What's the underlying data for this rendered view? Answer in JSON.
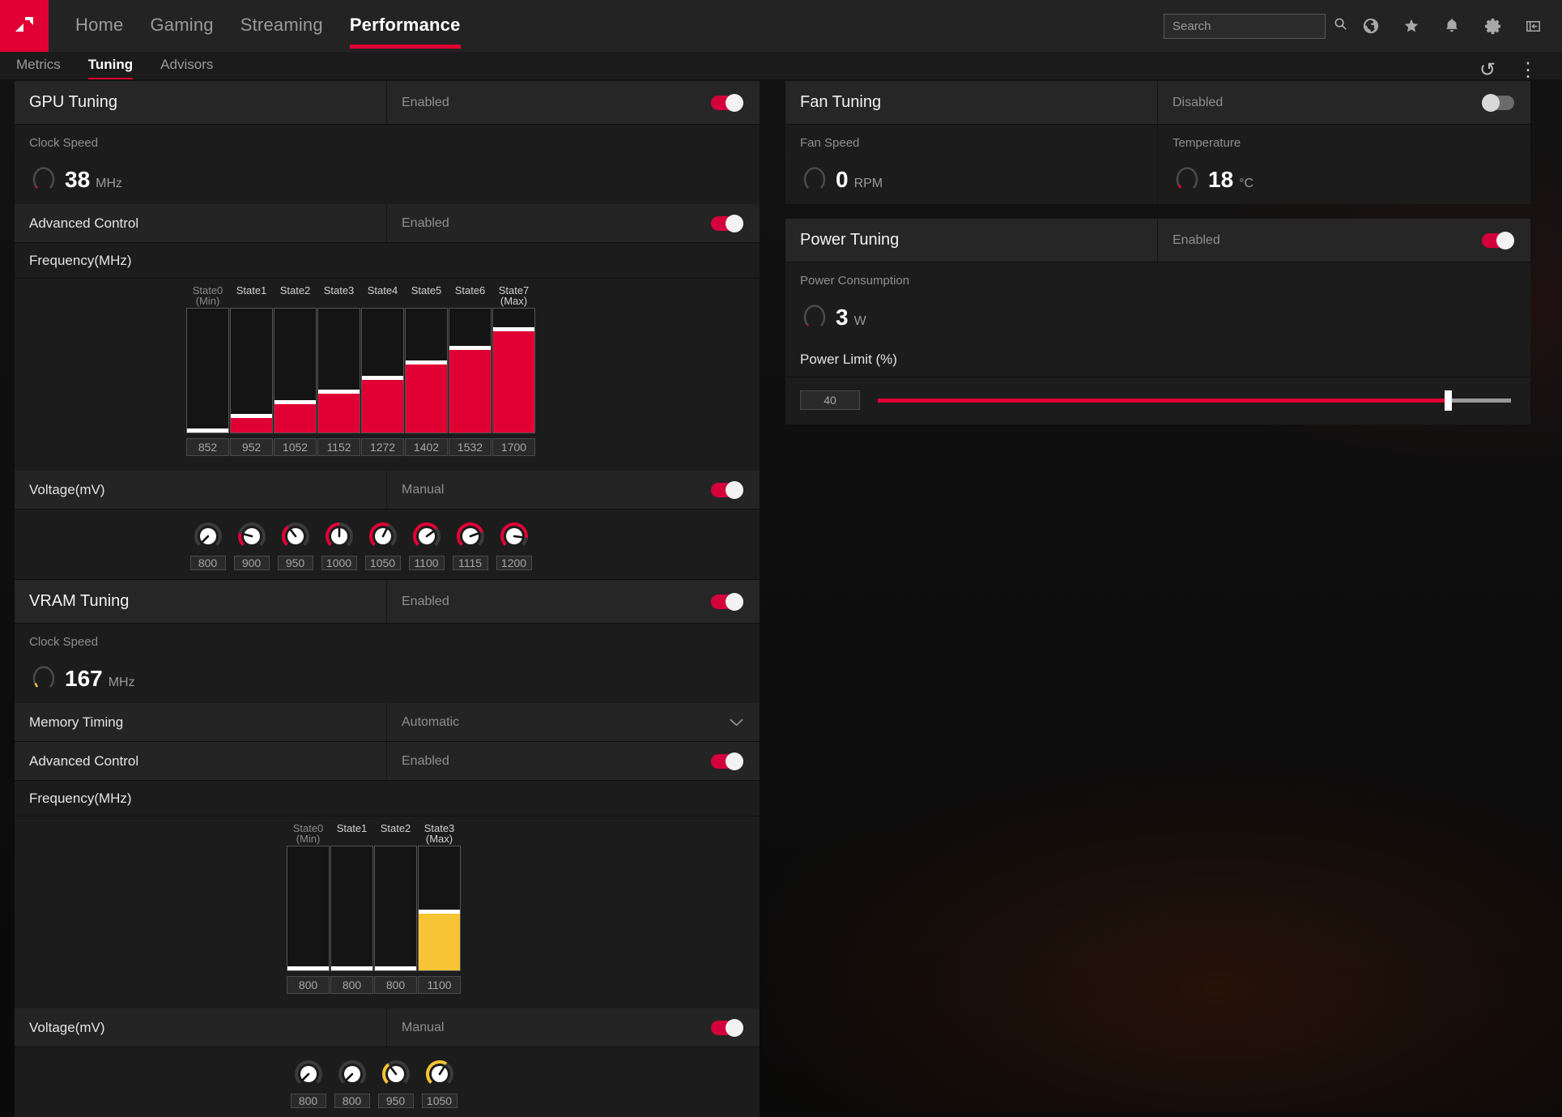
{
  "app": {
    "brand_color": "#e00034",
    "accent_yellow": "#f6c434",
    "logo_icon": "amd-arrow-icon"
  },
  "nav": {
    "items": [
      {
        "label": "Home",
        "active": false
      },
      {
        "label": "Gaming",
        "active": false
      },
      {
        "label": "Streaming",
        "active": false
      },
      {
        "label": "Performance",
        "active": true
      }
    ]
  },
  "search": {
    "placeholder": "Search",
    "value": "",
    "icon": "search-icon"
  },
  "topbar_icons": [
    {
      "name": "globe-icon"
    },
    {
      "name": "star-icon"
    },
    {
      "name": "bell-icon"
    },
    {
      "name": "gear-icon"
    },
    {
      "name": "panel-collapse-icon"
    }
  ],
  "subnav": {
    "items": [
      {
        "label": "Metrics",
        "active": false
      },
      {
        "label": "Tuning",
        "active": true
      },
      {
        "label": "Advisors",
        "active": false
      }
    ],
    "actions": [
      {
        "name": "reset-icon",
        "glyph": "↺"
      },
      {
        "name": "more-options-icon",
        "glyph": "⋮"
      }
    ]
  },
  "gpu_tuning": {
    "title": "GPU Tuning",
    "state_label": "Enabled",
    "enabled": true,
    "clock_speed": {
      "caption": "Clock Speed",
      "value": "38",
      "unit": "MHz",
      "gauge_pct": 4,
      "gauge_color": "#e00034"
    },
    "advanced_control": {
      "label": "Advanced Control",
      "state_label": "Enabled",
      "enabled": true
    },
    "frequency": {
      "label": "Frequency(MHz)"
    },
    "voltage": {
      "label": "Voltage(mV)",
      "state_label": "Manual",
      "enabled": true
    }
  },
  "vram_tuning": {
    "title": "VRAM Tuning",
    "state_label": "Enabled",
    "enabled": true,
    "clock_speed": {
      "caption": "Clock Speed",
      "value": "167",
      "unit": "MHz",
      "gauge_pct": 9,
      "gauge_color": "#f6c434"
    },
    "memory_timing": {
      "label": "Memory Timing",
      "value": "Automatic",
      "icon": "chevron-down-icon"
    },
    "advanced_control": {
      "label": "Advanced Control",
      "state_label": "Enabled",
      "enabled": true
    },
    "frequency": {
      "label": "Frequency(MHz)"
    },
    "voltage": {
      "label": "Voltage(mV)",
      "state_label": "Manual",
      "enabled": true
    }
  },
  "fan_tuning": {
    "title": "Fan Tuning",
    "state_label": "Disabled",
    "enabled": false,
    "fan_speed": {
      "caption": "Fan Speed",
      "value": "0",
      "unit": "RPM",
      "gauge_pct": 0,
      "gauge_color": "#e00034"
    },
    "temperature": {
      "caption": "Temperature",
      "value": "18",
      "unit": "°C",
      "gauge_pct": 7,
      "gauge_color": "#e00034"
    }
  },
  "power_tuning": {
    "title": "Power Tuning",
    "state_label": "Enabled",
    "enabled": true,
    "power_consumption": {
      "caption": "Power Consumption",
      "value": "3",
      "unit": "W",
      "gauge_pct": 3,
      "gauge_color": "#e00034"
    },
    "power_limit": {
      "label": "Power Limit (%)",
      "value": "40",
      "min": 0,
      "max": 100,
      "fill_pct": 90
    }
  },
  "chart_data": [
    {
      "type": "bar",
      "title": "GPU Frequency(MHz)",
      "ylabel": "MHz",
      "bar_color": "#e00034",
      "categories": [
        "State0\n(Min)",
        "State1",
        "State2",
        "State3",
        "State4",
        "State5",
        "State6",
        "State7\n(Max)"
      ],
      "category_lines": [
        [
          "State0",
          "(Min)"
        ],
        [
          "State1"
        ],
        [
          "State2"
        ],
        [
          "State3"
        ],
        [
          "State4"
        ],
        [
          "State5"
        ],
        [
          "State6"
        ],
        [
          "State7",
          "(Max)"
        ]
      ],
      "values": [
        852,
        952,
        1052,
        1152,
        1272,
        1402,
        1532,
        1700
      ],
      "fill_pct": [
        1,
        13,
        24,
        33,
        44,
        56,
        68,
        83
      ],
      "ylim": [
        800,
        1750
      ],
      "grid": false,
      "legend": "none"
    },
    {
      "type": "bar",
      "title": "VRAM Frequency(MHz)",
      "ylabel": "MHz",
      "bar_color": "#f6c434",
      "categories": [
        "State0\n(Min)",
        "State1",
        "State2",
        "State3\n(Max)"
      ],
      "category_lines": [
        [
          "State0",
          "(Min)"
        ],
        [
          "State1"
        ],
        [
          "State2"
        ],
        [
          "State3",
          "(Max)"
        ]
      ],
      "values": [
        800,
        800,
        800,
        1100
      ],
      "fill_pct": [
        1,
        1,
        1,
        47
      ],
      "ylim": [
        780,
        1180
      ],
      "grid": false,
      "legend": "none"
    },
    {
      "type": "table",
      "title": "GPU Voltage(mV)",
      "knob_color": "#e00034",
      "categories": [
        "State0",
        "State1",
        "State2",
        "State3",
        "State4",
        "State5",
        "State6",
        "State7"
      ],
      "values": [
        800,
        900,
        950,
        1000,
        1050,
        1100,
        1115,
        1200
      ],
      "arc_pct": [
        0,
        22,
        36,
        50,
        60,
        70,
        76,
        86
      ]
    },
    {
      "type": "table",
      "title": "VRAM Voltage(mV)",
      "knob_color": "#f6c434",
      "categories": [
        "State0",
        "State1",
        "State2",
        "State3"
      ],
      "values": [
        800,
        800,
        950,
        1050
      ],
      "arc_pct": [
        0,
        0,
        36,
        62
      ]
    }
  ]
}
